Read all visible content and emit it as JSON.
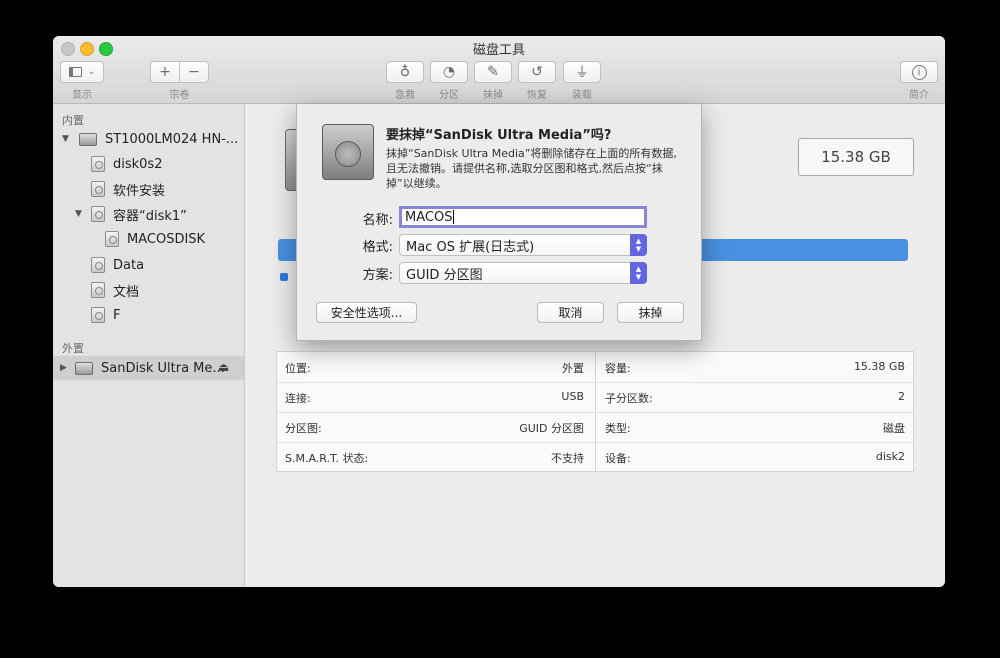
{
  "window": {
    "title": "磁盘工具"
  },
  "toolbar": {
    "view_label": "显示",
    "volume_label": "宗卷",
    "add_symbol": "+",
    "remove_symbol": "−",
    "firstaid_label": "急救",
    "partition_label": "分区",
    "erase_label": "抹掉",
    "restore_label": "恢复",
    "mount_label": "装载",
    "info_label": "简介"
  },
  "sidebar": {
    "internal_header": "内置",
    "external_header": "外置",
    "items": [
      {
        "label": "ST1000LM024 HN-..."
      },
      {
        "label": "disk0s2"
      },
      {
        "label": "软件安装"
      },
      {
        "label": "容器“disk1”"
      },
      {
        "label": "MACOSDISK"
      },
      {
        "label": "Data"
      },
      {
        "label": "文档"
      },
      {
        "label": "F"
      },
      {
        "label": "SanDisk Ultra Me..."
      }
    ],
    "eject_symbol": "⏏"
  },
  "main": {
    "capacity": "15.38 GB",
    "info": {
      "left": [
        {
          "key": "位置:",
          "value": "外置"
        },
        {
          "key": "连接:",
          "value": "USB"
        },
        {
          "key": "分区图:",
          "value": "GUID 分区图"
        },
        {
          "key": "S.M.A.R.T. 状态:",
          "value": "不支持"
        }
      ],
      "right": [
        {
          "key": "容量:",
          "value": "15.38 GB"
        },
        {
          "key": "子分区数:",
          "value": "2"
        },
        {
          "key": "类型:",
          "value": "磁盘"
        },
        {
          "key": "设备:",
          "value": "disk2"
        }
      ]
    }
  },
  "dialog": {
    "title": "要抹掉“SanDisk Ultra Media”吗?",
    "message": "抹掉“SanDisk Ultra Media”将删除储存在上面的所有数据,且无法撤销。请提供名称,选取分区图和格式,然后点按“抹掉”以继续。",
    "name_label": "名称:",
    "name_value": "MACOS",
    "format_label": "格式:",
    "format_value": "Mac OS 扩展(日志式)",
    "scheme_label": "方案:",
    "scheme_value": "GUID 分区图",
    "security_button": "安全性选项...",
    "cancel_button": "取消",
    "erase_button": "抹掉"
  },
  "colors": {
    "accent": "#6466e0",
    "usage_bar": "#4a90e2"
  }
}
